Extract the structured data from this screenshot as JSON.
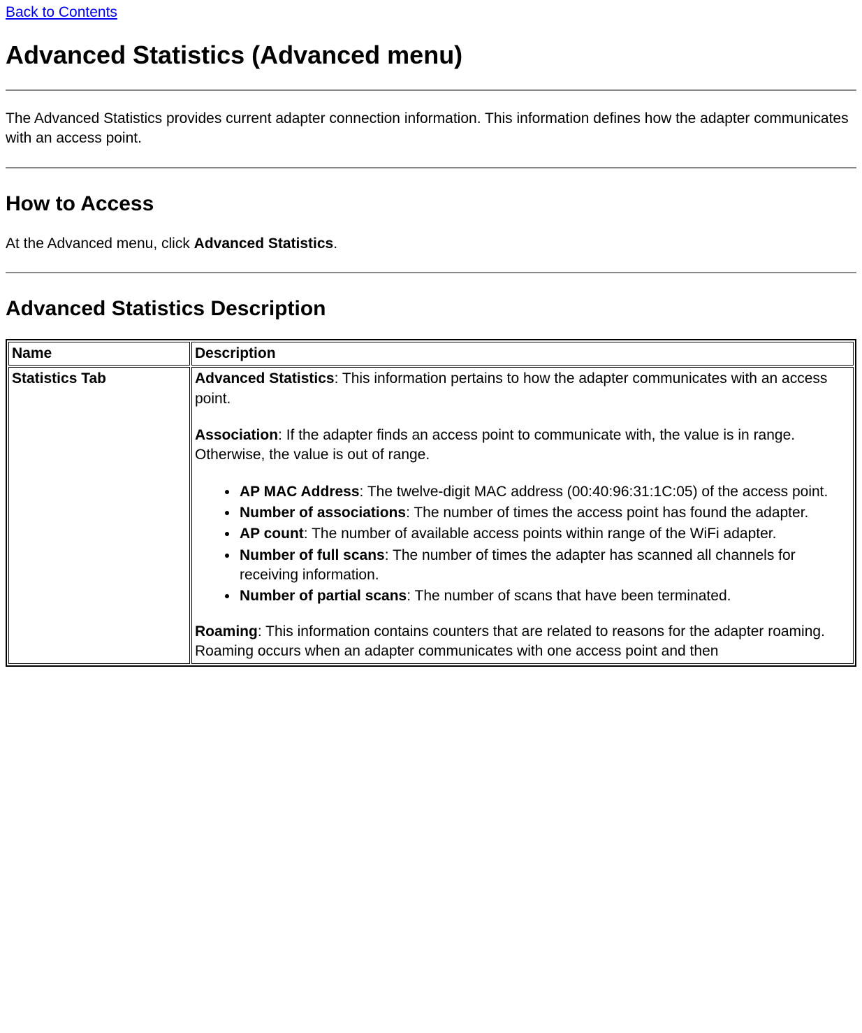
{
  "back_link": "Back to Contents",
  "h1": "Advanced Statistics (Advanced menu)",
  "intro": "The Advanced Statistics provides current adapter connection information. This information defines how the adapter communicates with an access point.",
  "h2_access": "How to Access",
  "access_text_pre": "At the Advanced menu, click ",
  "access_text_bold": "Advanced Statistics",
  "access_text_post": ".",
  "h2_desc": "Advanced Statistics Description",
  "table": {
    "headers": {
      "name": "Name",
      "description": "Description"
    },
    "row1": {
      "name": "Statistics Tab",
      "p1_bold": "Advanced Statistics",
      "p1_rest": ": This information pertains to how the adapter communicates with an access point.",
      "p2_bold": "Association",
      "p2_rest": ": If the adapter finds an access point to communicate with, the value is in range. Otherwise, the value is out of range.",
      "bullets": [
        {
          "bold": "AP MAC Address",
          "rest": ": The twelve-digit MAC address (00:40:96:31:1C:05) of the access point."
        },
        {
          "bold": "Number of associations",
          "rest": ": The number of times the access point has found the adapter."
        },
        {
          "bold": "AP count",
          "rest": ": The number of available access points within range of the WiFi adapter."
        },
        {
          "bold": "Number of full scans",
          "rest": ": The number of times the adapter has scanned all channels for receiving information."
        },
        {
          "bold": "Number of partial scans",
          "rest": ": The number of scans that have been terminated."
        }
      ],
      "p3_bold": "Roaming",
      "p3_rest": ": This information contains counters that are related to reasons for the adapter roaming. Roaming occurs when an adapter communicates with one access point and then"
    }
  }
}
